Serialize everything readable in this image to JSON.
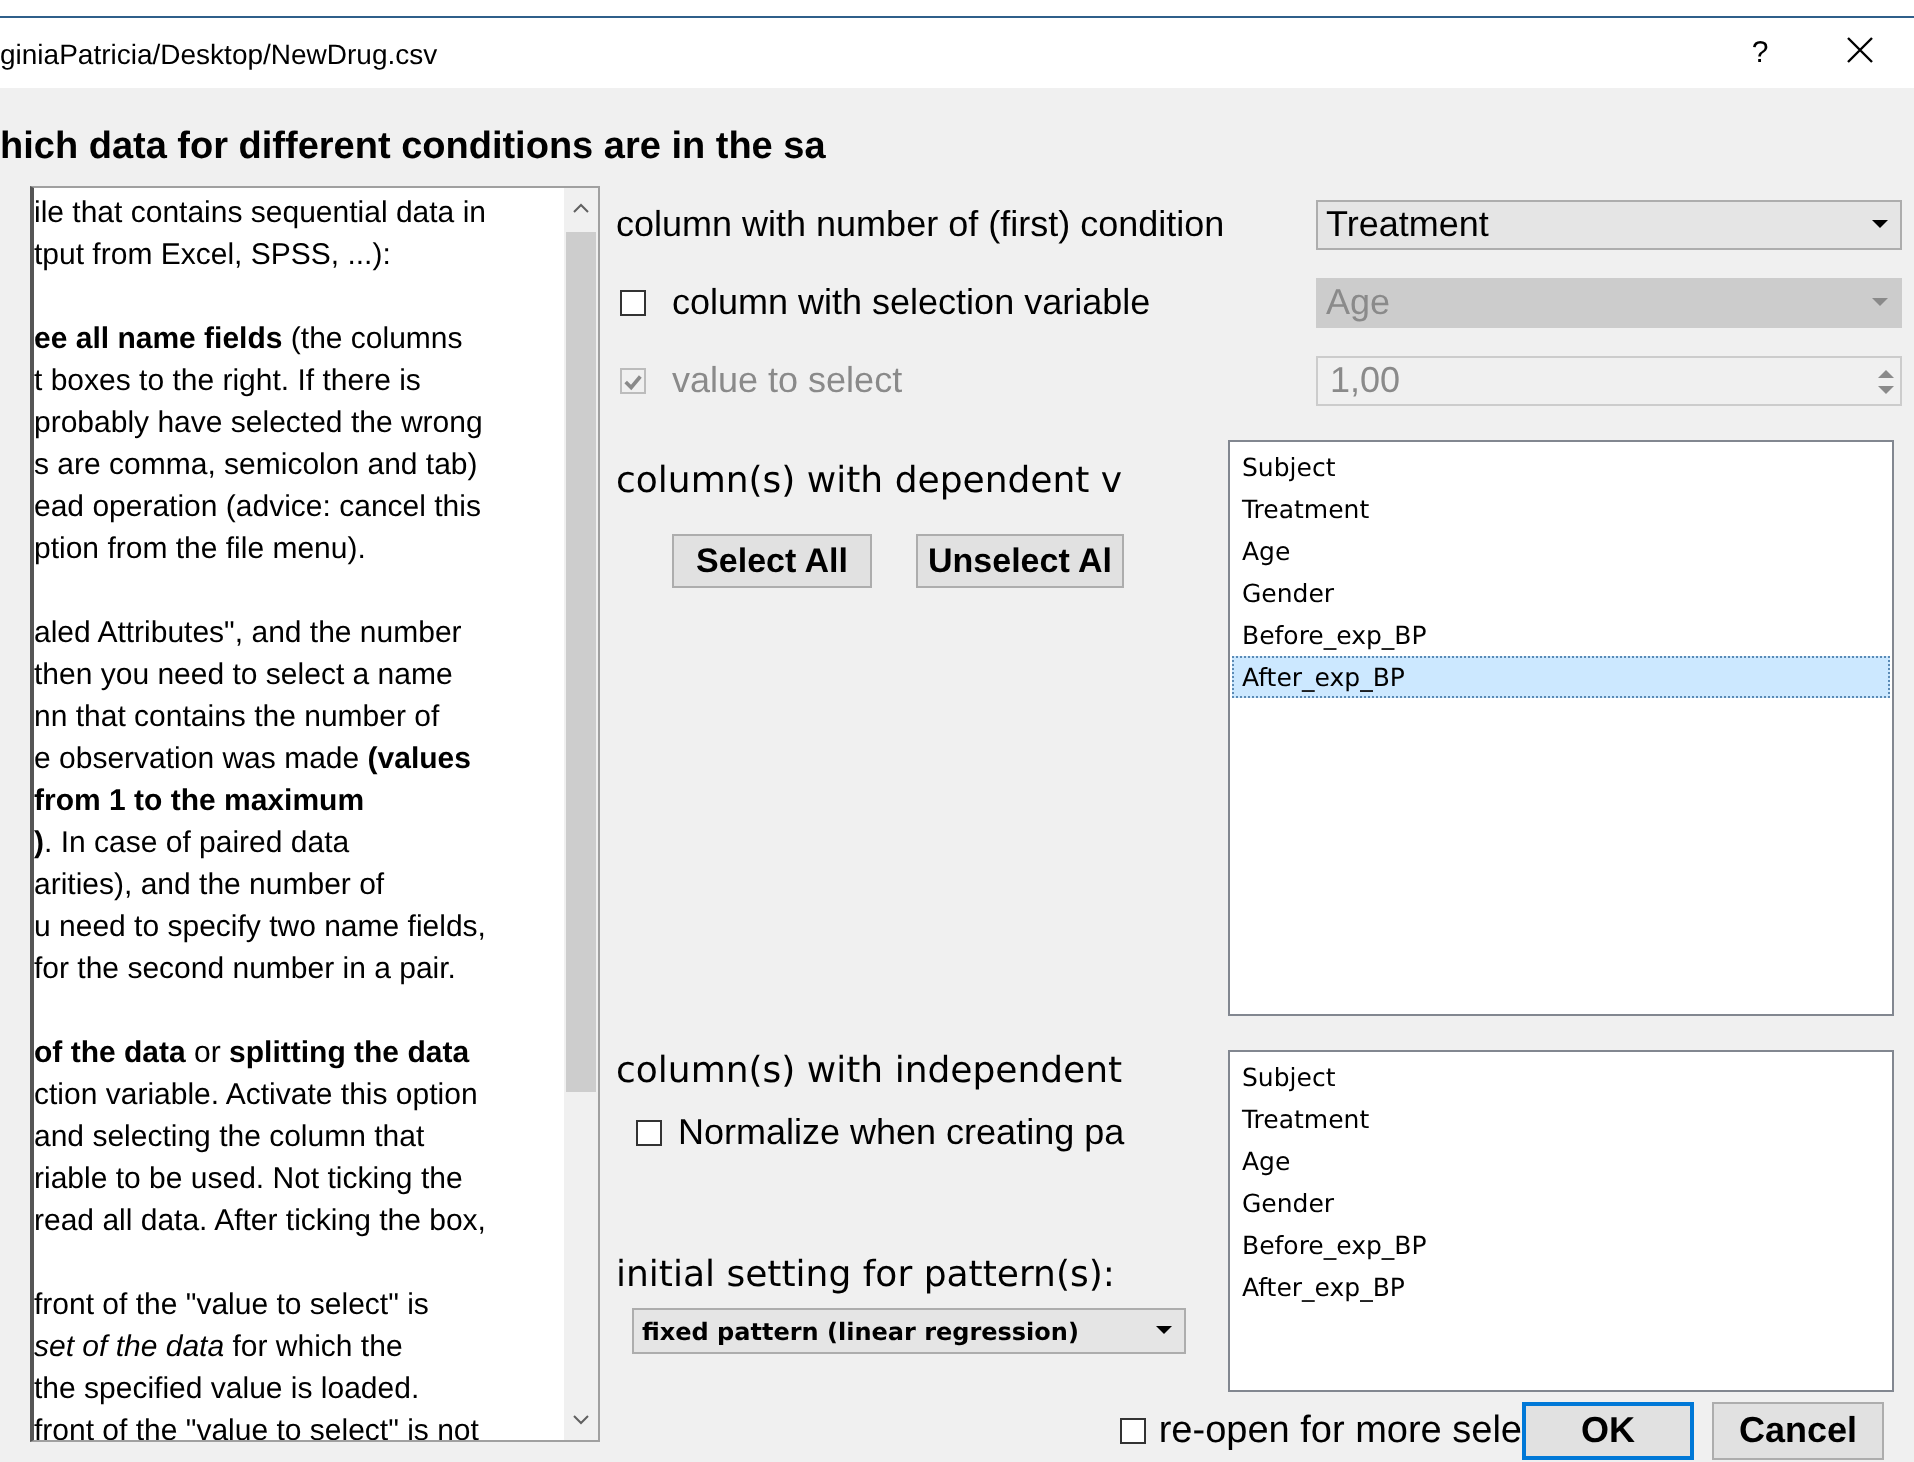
{
  "window": {
    "title": "giniaPatricia/Desktop/NewDrug.csv",
    "help": "?"
  },
  "heading": "hich data for different conditions are in the sa",
  "help": {
    "paragraphs": [
      [
        "ile that contains sequential data in",
        "tput from Excel, SPSS, ...):"
      ],
      [
        "**ee all name fields** (the columns",
        "t boxes to the right. If there is",
        "probably have selected the wrong",
        "s are comma, semicolon and tab)",
        "ead operation (advice: cancel this",
        "ption from the file menu)."
      ],
      [
        "aled Attributes\", and the number",
        " then you need to select a name",
        "nn that contains the number of",
        "e observation was made **(values**",
        "**from 1 to the maximum**",
        "**)**. In case of paired data",
        "arities), and the number of",
        "u need to specify two name fields,",
        " for the second number in a pair."
      ],
      [
        "**of the data** or **splitting the data**",
        "ction variable. Activate this option",
        "and selecting the column that",
        "riable to be used. Not ticking the",
        "read all data. After ticking the box,"
      ],
      [
        "front of the \"value to select\" is",
        "*set of the data* for which the",
        " the specified value is loaded.",
        "front of the \"value to select\" is not"
      ]
    ]
  },
  "condition": {
    "label": "column with number of (first) condition",
    "value": "Treatment"
  },
  "selection": {
    "label": "column with selection variable",
    "checked": false,
    "disabled": false,
    "value": "Age",
    "value_disabled": true
  },
  "value_select": {
    "label": "value to select",
    "checked": true,
    "disabled": true,
    "value": "1,00"
  },
  "dependent": {
    "label": "column(s) with dependent v",
    "buttons": [
      "Select All",
      "Unselect Al"
    ],
    "items": [
      {
        "label": "Subject",
        "selected": false
      },
      {
        "label": "Treatment",
        "selected": false
      },
      {
        "label": "Age",
        "selected": false
      },
      {
        "label": "Gender",
        "selected": false
      },
      {
        "label": "Before_exp_BP",
        "selected": false
      },
      {
        "label": "After_exp_BP",
        "selected": true
      }
    ]
  },
  "independent": {
    "label": "column(s) with independent",
    "normalize": {
      "label": "Normalize when creating pa",
      "checked": false
    },
    "items": [
      {
        "label": "Subject",
        "selected": false
      },
      {
        "label": "Treatment",
        "selected": false
      },
      {
        "label": "Age",
        "selected": false
      },
      {
        "label": "Gender",
        "selected": false
      },
      {
        "label": "Before_exp_BP",
        "selected": false
      },
      {
        "label": "After_exp_BP",
        "selected": false
      }
    ]
  },
  "pattern": {
    "label": "initial setting for pattern(s):",
    "value": "fixed pattern (linear regression)"
  },
  "reopen": {
    "label": "re-open for more sele",
    "checked": false
  },
  "buttons": [
    {
      "label": "OK",
      "focused": true
    },
    {
      "label": "Cancel",
      "focused": false
    }
  ]
}
